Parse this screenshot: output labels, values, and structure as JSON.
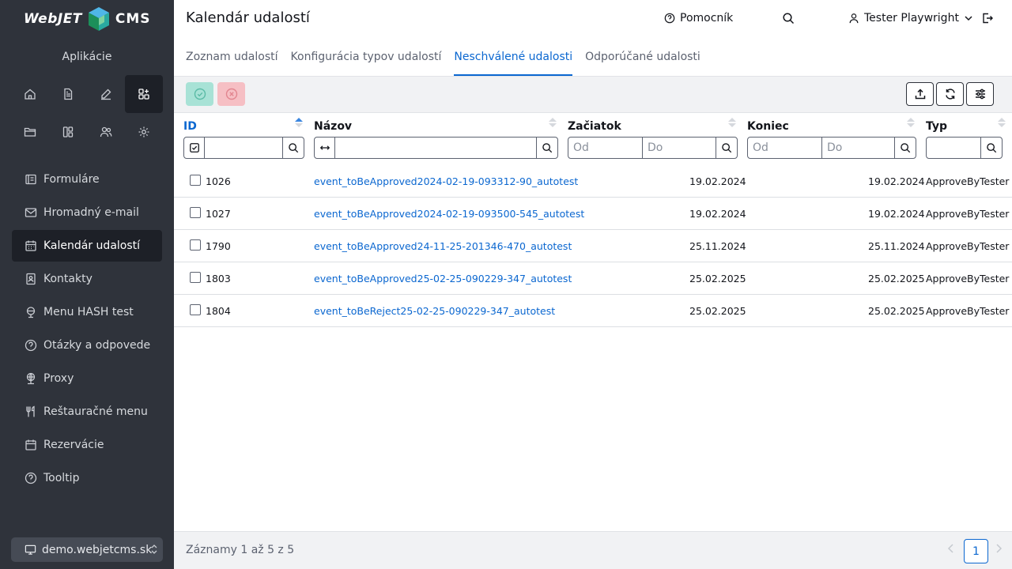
{
  "sidebar": {
    "logo_left": "WebJET",
    "logo_right": "CMS",
    "apps_title": "Aplikácie",
    "icons": [
      "home-icon",
      "document-icon",
      "edit-icon",
      "apps-icon",
      "folder-icon",
      "layout-icon",
      "users-icon",
      "gear-icon"
    ],
    "items": [
      {
        "label": "Formuláre",
        "icon": "form-icon"
      },
      {
        "label": "Hromadný e-mail",
        "icon": "mail-icon"
      },
      {
        "label": "Kalendár udalostí",
        "icon": "calendar-icon"
      },
      {
        "label": "Kontakty",
        "icon": "contacts-icon"
      },
      {
        "label": "Menu HASH test",
        "icon": "globe-icon"
      },
      {
        "label": "Otázky a odpovede",
        "icon": "question-icon"
      },
      {
        "label": "Proxy",
        "icon": "proxy-icon"
      },
      {
        "label": "Reštauračné menu",
        "icon": "restaurant-icon"
      },
      {
        "label": "Rezervácie",
        "icon": "calendar-icon"
      },
      {
        "label": "Tooltip",
        "icon": "question-icon"
      }
    ],
    "domain": "demo.webjetcms.sk"
  },
  "header": {
    "title": "Kalendár udalostí",
    "help": "Pomocník",
    "user": "Tester Playwright"
  },
  "tabs": [
    {
      "label": "Zoznam udalostí"
    },
    {
      "label": "Konfigurácia typov udalostí"
    },
    {
      "label": "Neschválené udalosti"
    },
    {
      "label": "Odporúčané udalosti"
    }
  ],
  "table": {
    "columns": {
      "id": "ID",
      "name": "Názov",
      "start": "Začiatok",
      "end": "Koniec",
      "type": "Typ"
    },
    "placeholders": {
      "from": "Od",
      "to": "Do"
    },
    "rows": [
      {
        "id": "1026",
        "name": "event_toBeApproved2024-02-19-093312-90_autotest",
        "start": "19.02.2024",
        "end": "19.02.2024",
        "type": "ApproveByTester"
      },
      {
        "id": "1027",
        "name": "event_toBeApproved2024-02-19-093500-545_autotest",
        "start": "19.02.2024",
        "end": "19.02.2024",
        "type": "ApproveByTester"
      },
      {
        "id": "1790",
        "name": "event_toBeApproved24-11-25-201346-470_autotest",
        "start": "25.11.2024",
        "end": "25.11.2024",
        "type": "ApproveByTester"
      },
      {
        "id": "1803",
        "name": "event_toBeApproved25-02-25-090229-347_autotest",
        "start": "25.02.2025",
        "end": "25.02.2025",
        "type": "ApproveByTester"
      },
      {
        "id": "1804",
        "name": "event_toBeReject25-02-25-090229-347_autotest",
        "start": "25.02.2025",
        "end": "25.02.2025",
        "type": "ApproveByTester"
      }
    ]
  },
  "footer": {
    "info": "Záznamy 1 až 5 z 5",
    "page": "1"
  },
  "colors": {
    "sidebar_bg": "#2f333b",
    "accent": "#0b67d0",
    "approve": "#a8e2d6",
    "reject": "#f6bfc4"
  }
}
